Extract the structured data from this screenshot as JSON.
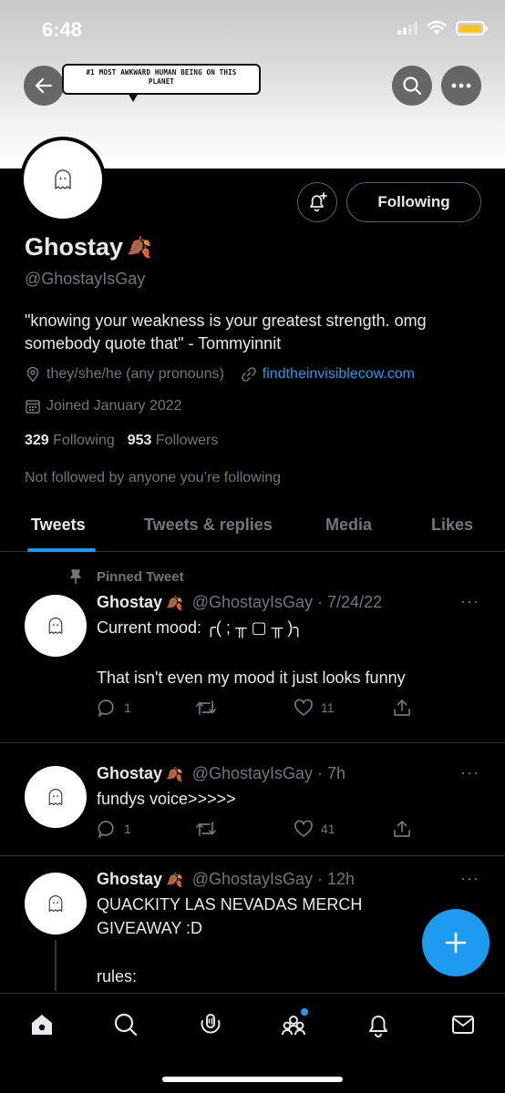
{
  "status_bar": {
    "time": "6:48",
    "battery_color": "#f5c518"
  },
  "header": {
    "banner_text_line1": "#1 MOST AWKWARD HUMAN BEING ON THIS",
    "banner_text_line2": "PLANET",
    "back_icon": "arrow-left-icon",
    "search_icon": "search-icon",
    "more_icon": "more-icon"
  },
  "profile": {
    "name": "Ghostay",
    "name_emoji": "🍂",
    "handle": "@GhostayIsGay",
    "bio": "\"knowing your weakness is your greatest strength. omg somebody quote that\" - Tommyinnit",
    "pronouns": "they/she/he (any pronouns)",
    "website": "findtheinvisiblecow.com",
    "joined": "Joined January 2022",
    "following_count": "329",
    "following_label": "Following",
    "followers_count": "953",
    "followers_label": "Followers",
    "not_followed_text": "Not followed by anyone you’re following",
    "follow_button_label": "Following"
  },
  "tabs": [
    {
      "label": "Tweets",
      "active": true
    },
    {
      "label": "Tweets & replies",
      "active": false
    },
    {
      "label": "Media",
      "active": false
    },
    {
      "label": "Likes",
      "active": false
    }
  ],
  "tweets": [
    {
      "pinned_label": "Pinned Tweet",
      "name": "Ghostay",
      "emoji": "🍂",
      "handle_time": "@GhostayIsGay · 7/24/22",
      "text_line1": "Current mood: ╭( ; ╥ ▢ ╥ )╮",
      "text_line2": "That isn't even my mood it just looks funny",
      "replies": "1",
      "retweets": "",
      "likes": "11"
    },
    {
      "name": "Ghostay",
      "emoji": "🍂",
      "handle_time": "@GhostayIsGay · 7h",
      "text_line1": "fundys voice>>>>>",
      "replies": "1",
      "retweets": "",
      "likes": "41"
    },
    {
      "name": "Ghostay",
      "emoji": "🍂",
      "handle_time": "@GhostayIsGay · 12h",
      "text_line1": "QUACKITY LAS NEVADAS MERCH",
      "text_line2": "GIVEAWAY :D",
      "text_line3": "rules:"
    }
  ],
  "colors": {
    "accent": "#1d9bf0",
    "muted": "#71767b",
    "text": "#e7e9ea",
    "divider": "#2f3336"
  },
  "bottom_nav": [
    "home-icon",
    "search-icon",
    "spaces-icon",
    "communities-icon",
    "notifications-icon",
    "messages-icon"
  ]
}
